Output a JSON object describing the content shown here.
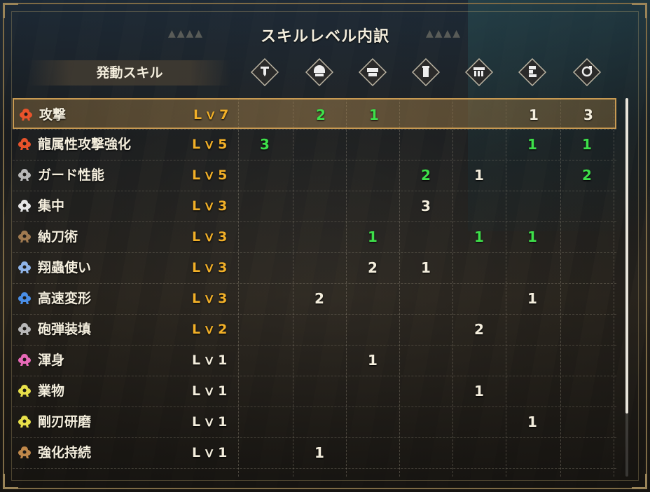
{
  "title": "スキルレベル内訳",
  "header_label": "発動スキル",
  "equipment_icons": [
    "weapon-icon",
    "helm-icon",
    "chest-icon",
    "arm-icon",
    "waist-icon",
    "leg-icon",
    "talisman-icon"
  ],
  "colors": {
    "gold": "#f2b028",
    "green": "#3ee04a",
    "white": "#f4eedd",
    "selected_border": "#c89a52"
  },
  "skills": [
    {
      "name": "攻撃",
      "lv": "Lｖ7",
      "lv_color": "gold",
      "icon_color": "#e8532b",
      "selected": true,
      "cells": [
        {
          "v": "",
          "c": ""
        },
        {
          "v": "2",
          "c": "green"
        },
        {
          "v": "1",
          "c": "green"
        },
        {
          "v": "",
          "c": ""
        },
        {
          "v": "",
          "c": ""
        },
        {
          "v": "1",
          "c": "white"
        },
        {
          "v": "3",
          "c": "white"
        }
      ]
    },
    {
      "name": "龍属性攻撃強化",
      "lv": "Lｖ5",
      "lv_color": "gold",
      "icon_color": "#e8532b",
      "selected": false,
      "cells": [
        {
          "v": "3",
          "c": "green"
        },
        {
          "v": "",
          "c": ""
        },
        {
          "v": "",
          "c": ""
        },
        {
          "v": "",
          "c": ""
        },
        {
          "v": "",
          "c": ""
        },
        {
          "v": "1",
          "c": "green"
        },
        {
          "v": "1",
          "c": "green"
        }
      ]
    },
    {
      "name": "ガード性能",
      "lv": "Lｖ5",
      "lv_color": "gold",
      "icon_color": "#b8b8b8",
      "selected": false,
      "cells": [
        {
          "v": "",
          "c": ""
        },
        {
          "v": "",
          "c": ""
        },
        {
          "v": "",
          "c": ""
        },
        {
          "v": "2",
          "c": "green"
        },
        {
          "v": "1",
          "c": "white"
        },
        {
          "v": "",
          "c": ""
        },
        {
          "v": "2",
          "c": "green"
        }
      ]
    },
    {
      "name": "集中",
      "lv": "Lｖ3",
      "lv_color": "gold",
      "icon_color": "#e6e6e6",
      "selected": false,
      "cells": [
        {
          "v": "",
          "c": ""
        },
        {
          "v": "",
          "c": ""
        },
        {
          "v": "",
          "c": ""
        },
        {
          "v": "3",
          "c": "white"
        },
        {
          "v": "",
          "c": ""
        },
        {
          "v": "",
          "c": ""
        },
        {
          "v": "",
          "c": ""
        }
      ]
    },
    {
      "name": "納刀術",
      "lv": "Lｖ3",
      "lv_color": "gold",
      "icon_color": "#a07a50",
      "selected": false,
      "cells": [
        {
          "v": "",
          "c": ""
        },
        {
          "v": "",
          "c": ""
        },
        {
          "v": "1",
          "c": "green"
        },
        {
          "v": "",
          "c": ""
        },
        {
          "v": "1",
          "c": "green"
        },
        {
          "v": "1",
          "c": "green"
        },
        {
          "v": "",
          "c": ""
        }
      ]
    },
    {
      "name": "翔蟲使い",
      "lv": "Lｖ3",
      "lv_color": "gold",
      "icon_color": "#8fb4e8",
      "selected": false,
      "cells": [
        {
          "v": "",
          "c": ""
        },
        {
          "v": "",
          "c": ""
        },
        {
          "v": "2",
          "c": "white"
        },
        {
          "v": "1",
          "c": "white"
        },
        {
          "v": "",
          "c": ""
        },
        {
          "v": "",
          "c": ""
        },
        {
          "v": "",
          "c": ""
        }
      ]
    },
    {
      "name": "高速変形",
      "lv": "Lｖ3",
      "lv_color": "gold",
      "icon_color": "#4a8fe8",
      "selected": false,
      "cells": [
        {
          "v": "",
          "c": ""
        },
        {
          "v": "2",
          "c": "white"
        },
        {
          "v": "",
          "c": ""
        },
        {
          "v": "",
          "c": ""
        },
        {
          "v": "",
          "c": ""
        },
        {
          "v": "1",
          "c": "white"
        },
        {
          "v": "",
          "c": ""
        }
      ]
    },
    {
      "name": "砲弾装填",
      "lv": "Lｖ2",
      "lv_color": "gold",
      "icon_color": "#b8b8b8",
      "selected": false,
      "cells": [
        {
          "v": "",
          "c": ""
        },
        {
          "v": "",
          "c": ""
        },
        {
          "v": "",
          "c": ""
        },
        {
          "v": "",
          "c": ""
        },
        {
          "v": "2",
          "c": "white"
        },
        {
          "v": "",
          "c": ""
        },
        {
          "v": "",
          "c": ""
        }
      ]
    },
    {
      "name": "渾身",
      "lv": "Lｖ1",
      "lv_color": "white",
      "icon_color": "#e86ab8",
      "selected": false,
      "cells": [
        {
          "v": "",
          "c": ""
        },
        {
          "v": "",
          "c": ""
        },
        {
          "v": "1",
          "c": "white"
        },
        {
          "v": "",
          "c": ""
        },
        {
          "v": "",
          "c": ""
        },
        {
          "v": "",
          "c": ""
        },
        {
          "v": "",
          "c": ""
        }
      ]
    },
    {
      "name": "業物",
      "lv": "Lｖ1",
      "lv_color": "white",
      "icon_color": "#e8e04a",
      "selected": false,
      "cells": [
        {
          "v": "",
          "c": ""
        },
        {
          "v": "",
          "c": ""
        },
        {
          "v": "",
          "c": ""
        },
        {
          "v": "",
          "c": ""
        },
        {
          "v": "1",
          "c": "white"
        },
        {
          "v": "",
          "c": ""
        },
        {
          "v": "",
          "c": ""
        }
      ]
    },
    {
      "name": "剛刃研磨",
      "lv": "Lｖ1",
      "lv_color": "white",
      "icon_color": "#e8e04a",
      "selected": false,
      "cells": [
        {
          "v": "",
          "c": ""
        },
        {
          "v": "",
          "c": ""
        },
        {
          "v": "",
          "c": ""
        },
        {
          "v": "",
          "c": ""
        },
        {
          "v": "",
          "c": ""
        },
        {
          "v": "1",
          "c": "white"
        },
        {
          "v": "",
          "c": ""
        }
      ]
    },
    {
      "name": "強化持続",
      "lv": "Lｖ1",
      "lv_color": "white",
      "icon_color": "#c0884a",
      "selected": false,
      "cells": [
        {
          "v": "",
          "c": ""
        },
        {
          "v": "1",
          "c": "white"
        },
        {
          "v": "",
          "c": ""
        },
        {
          "v": "",
          "c": ""
        },
        {
          "v": "",
          "c": ""
        },
        {
          "v": "",
          "c": ""
        },
        {
          "v": "",
          "c": ""
        }
      ]
    }
  ]
}
